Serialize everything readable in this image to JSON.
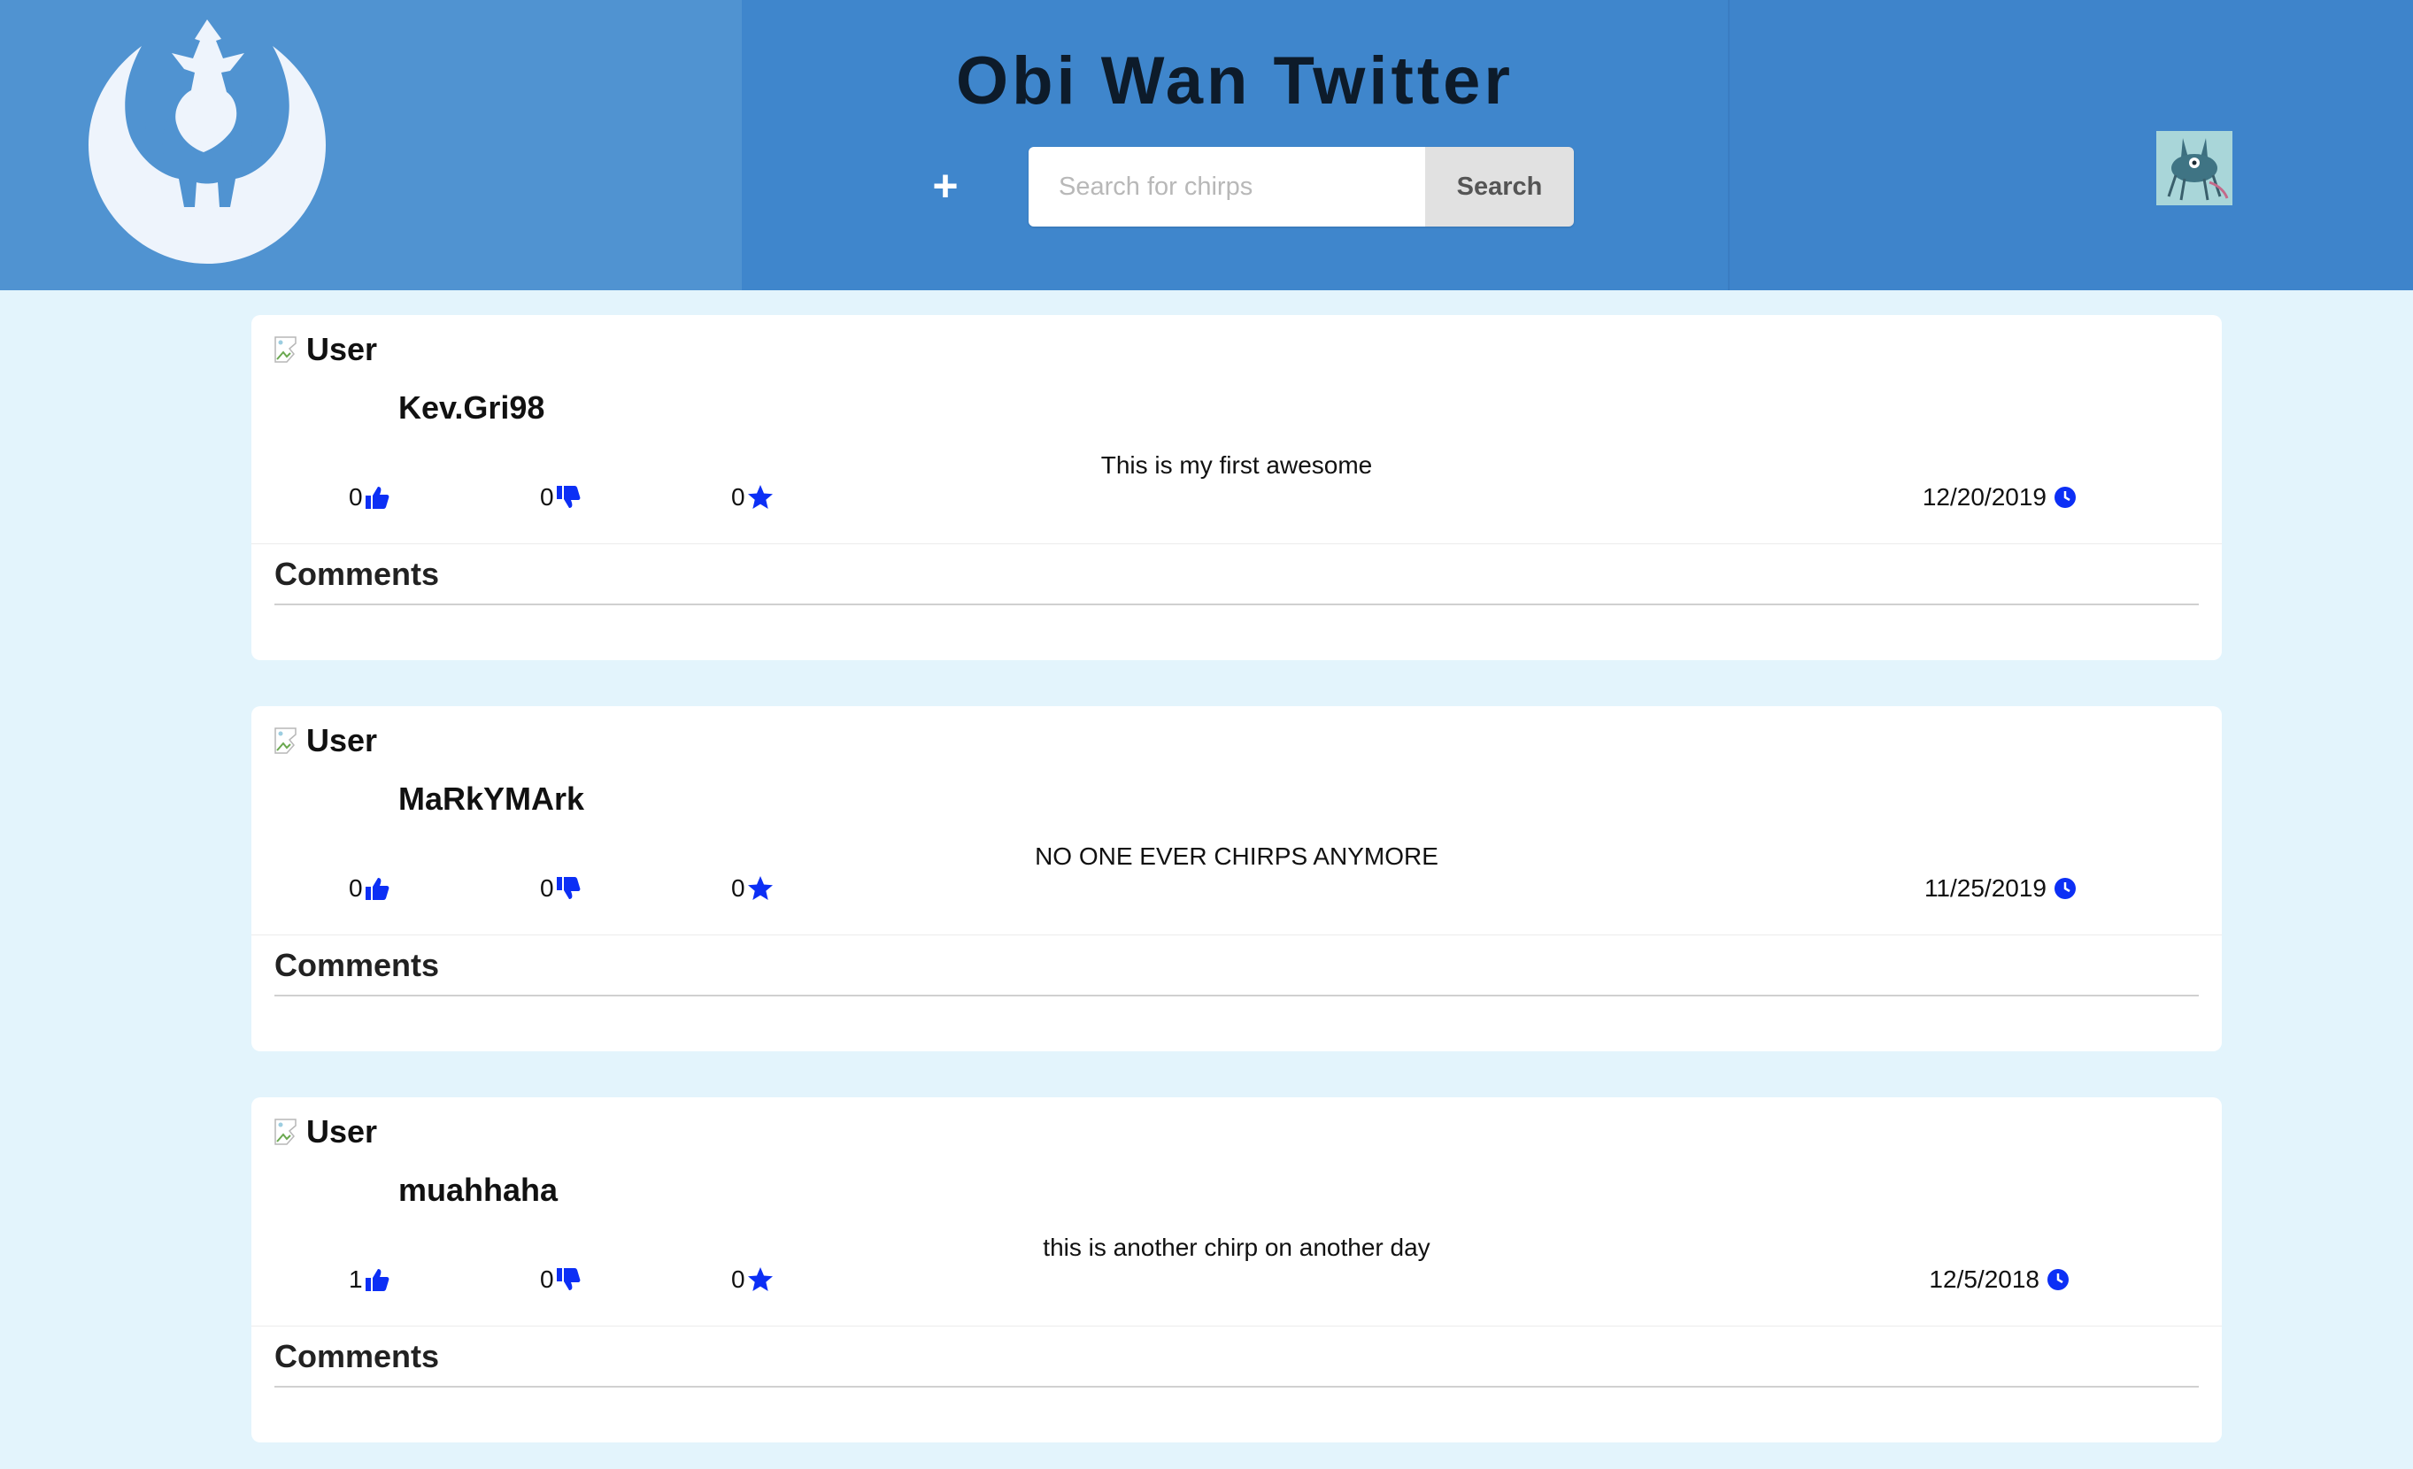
{
  "header": {
    "title": "Obi Wan Twitter",
    "add_label": "+",
    "search": {
      "placeholder": "Search for chirps",
      "button_label": "Search"
    }
  },
  "icons": {
    "logo": "rebel-alliance-logo-icon",
    "add": "plus-icon",
    "like": "thumbs-up-icon",
    "dislike": "thumbs-down-icon",
    "favorite": "star-icon",
    "time": "clock-icon"
  },
  "colors": {
    "header_bg": "#3f86cc",
    "header_left_bg": "#5093d1",
    "page_bg": "#e3f4fc",
    "accent": "#0c2ff5"
  },
  "chirps": [
    {
      "image_alt": "User",
      "username": "Kev.Gri98",
      "text": "This is my first awesome",
      "likes": "0",
      "dislikes": "0",
      "favorites": "0",
      "date": "12/20/2019",
      "comments_label": "Comments"
    },
    {
      "image_alt": "User",
      "username": "MaRkYMArk",
      "text": "NO ONE EVER CHIRPS ANYMORE",
      "likes": "0",
      "dislikes": "0",
      "favorites": "0",
      "date": "11/25/2019",
      "comments_label": "Comments"
    },
    {
      "image_alt": "User",
      "username": "muahhaha",
      "text": "this is another chirp on another day",
      "likes": "1",
      "dislikes": "0",
      "favorites": "0",
      "date": "12/5/2018",
      "comments_label": "Comments"
    }
  ]
}
